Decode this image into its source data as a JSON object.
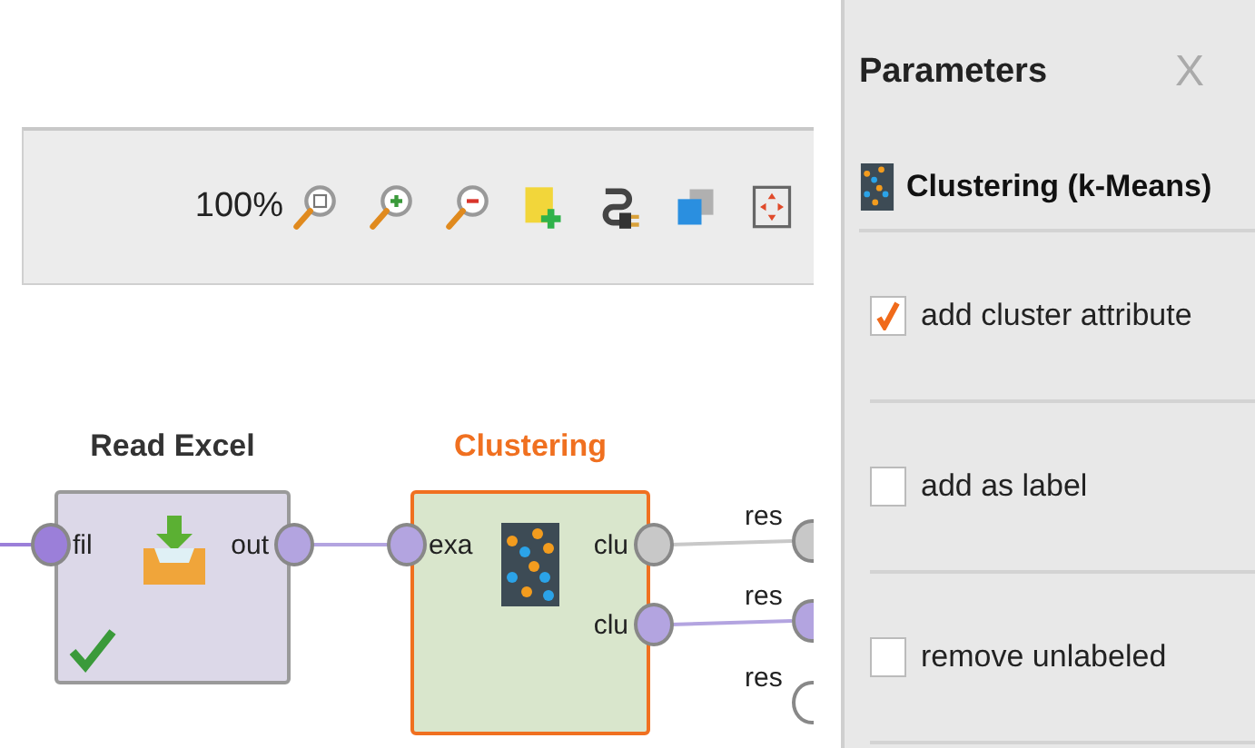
{
  "toolbar": {
    "zoom": "100%"
  },
  "operators": [
    {
      "title": "Read Excel",
      "kind": "read-excel",
      "selected": false,
      "executed": true,
      "inputs": [
        {
          "label": "fil",
          "color": "#9b7fd9"
        }
      ],
      "outputs": [
        {
          "label": "out",
          "color": "#b3a4e0"
        }
      ]
    },
    {
      "title": "Clustering",
      "kind": "clustering",
      "selected": true,
      "executed": false,
      "inputs": [
        {
          "label": "exa",
          "color": "#b3a4e0"
        }
      ],
      "outputs": [
        {
          "label": "clu",
          "color": "#c8c8c8"
        },
        {
          "label": "clu",
          "color": "#b3a4e0"
        }
      ]
    }
  ],
  "results": [
    {
      "label": "res",
      "color": "#c8c8c8"
    },
    {
      "label": "res",
      "color": "#b3a4e0"
    },
    {
      "label": "res",
      "color": "#ffffff"
    }
  ],
  "parameters": {
    "title": "Parameters",
    "close": "X",
    "operator": "Clustering (k-Means)",
    "items": [
      {
        "label": "add cluster attribute",
        "checked": true
      },
      {
        "label": "add as label",
        "checked": false
      },
      {
        "label": "remove unlabeled",
        "checked": false
      }
    ]
  }
}
